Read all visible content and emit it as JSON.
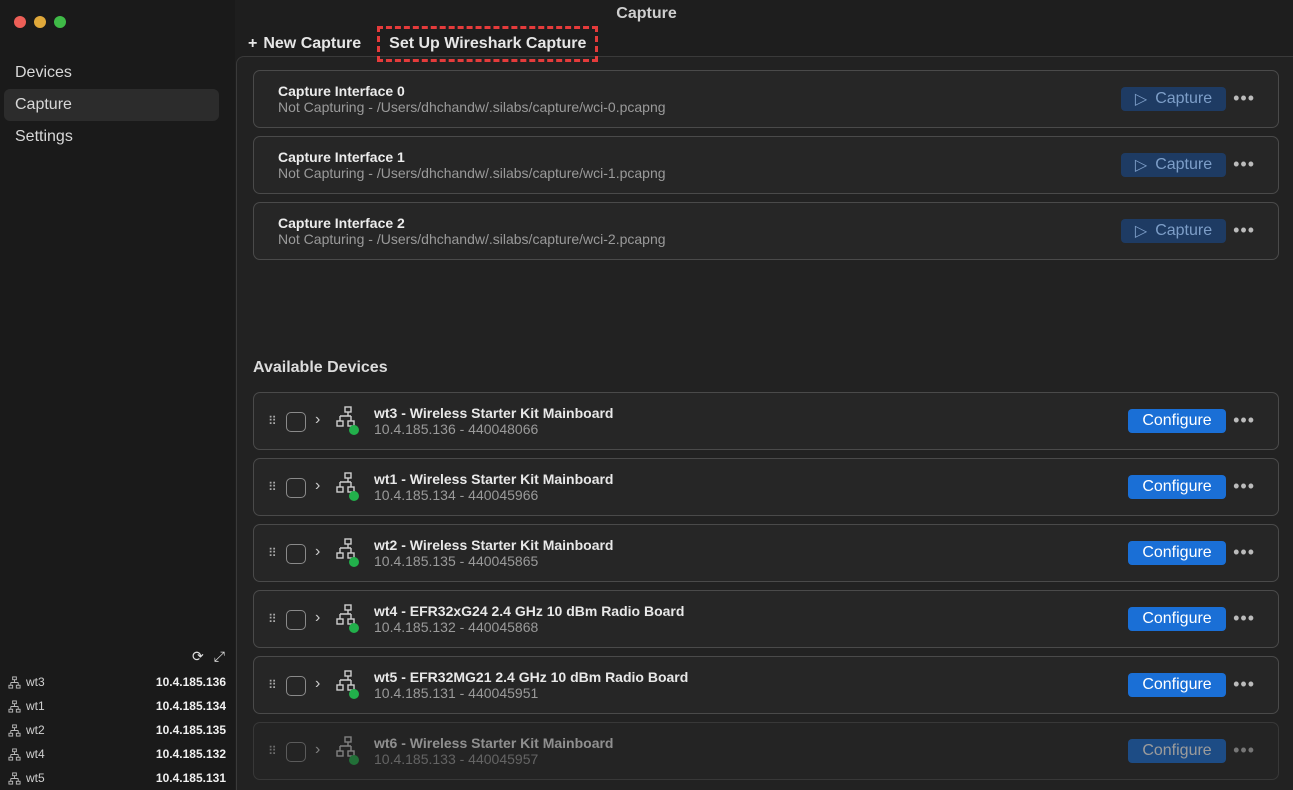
{
  "window": {
    "title": "Capture",
    "traffic_colors": [
      "#ed5f57",
      "#e0a83a",
      "#3fba47"
    ]
  },
  "sidebar": {
    "items": [
      {
        "label": "Devices",
        "active": false
      },
      {
        "label": "Capture",
        "active": true
      },
      {
        "label": "Settings",
        "active": false
      }
    ],
    "actions": [
      "refresh-icon",
      "expand-icon"
    ],
    "devices": [
      {
        "name": "wt3",
        "ip": "10.4.185.136"
      },
      {
        "name": "wt1",
        "ip": "10.4.185.134"
      },
      {
        "name": "wt2",
        "ip": "10.4.185.135"
      },
      {
        "name": "wt4",
        "ip": "10.4.185.132"
      },
      {
        "name": "wt5",
        "ip": "10.4.185.131"
      }
    ]
  },
  "toolbar": {
    "new_capture_icon": "+",
    "new_capture_label": "New Capture",
    "setup_label": "Set Up Wireshark Capture"
  },
  "interfaces": [
    {
      "name": "Capture Interface 0",
      "path": "Not Capturing - /Users/dhchandw/.silabs/capture/wci-0.pcapng",
      "button": "Capture"
    },
    {
      "name": "Capture Interface 1",
      "path": "Not Capturing - /Users/dhchandw/.silabs/capture/wci-1.pcapng",
      "button": "Capture"
    },
    {
      "name": "Capture Interface 2",
      "path": "Not Capturing - /Users/dhchandw/.silabs/capture/wci-2.pcapng",
      "button": "Capture"
    }
  ],
  "available": {
    "title": "Available Devices",
    "button_label": "Configure",
    "more_label": "•••",
    "devices": [
      {
        "name": "wt3 - Wireless Starter Kit Mainboard",
        "sub": "10.4.185.136 - 440048066"
      },
      {
        "name": "wt1 - Wireless Starter Kit Mainboard",
        "sub": "10.4.185.134 - 440045966"
      },
      {
        "name": "wt2 - Wireless Starter Kit Mainboard",
        "sub": "10.4.185.135 - 440045865"
      },
      {
        "name": "wt4 - EFR32xG24 2.4 GHz 10 dBm Radio Board",
        "sub": "10.4.185.132 - 440045868"
      },
      {
        "name": "wt5 - EFR32MG21 2.4 GHz 10 dBm Radio Board",
        "sub": "10.4.185.131 - 440045951"
      },
      {
        "name": "wt6 - Wireless Starter Kit Mainboard",
        "sub": "10.4.185.133 - 440045957"
      }
    ]
  },
  "colors": {
    "status_online": "#22b04b",
    "configure_button": "#1a6fd6",
    "highlight_box": "#e53b3b"
  }
}
